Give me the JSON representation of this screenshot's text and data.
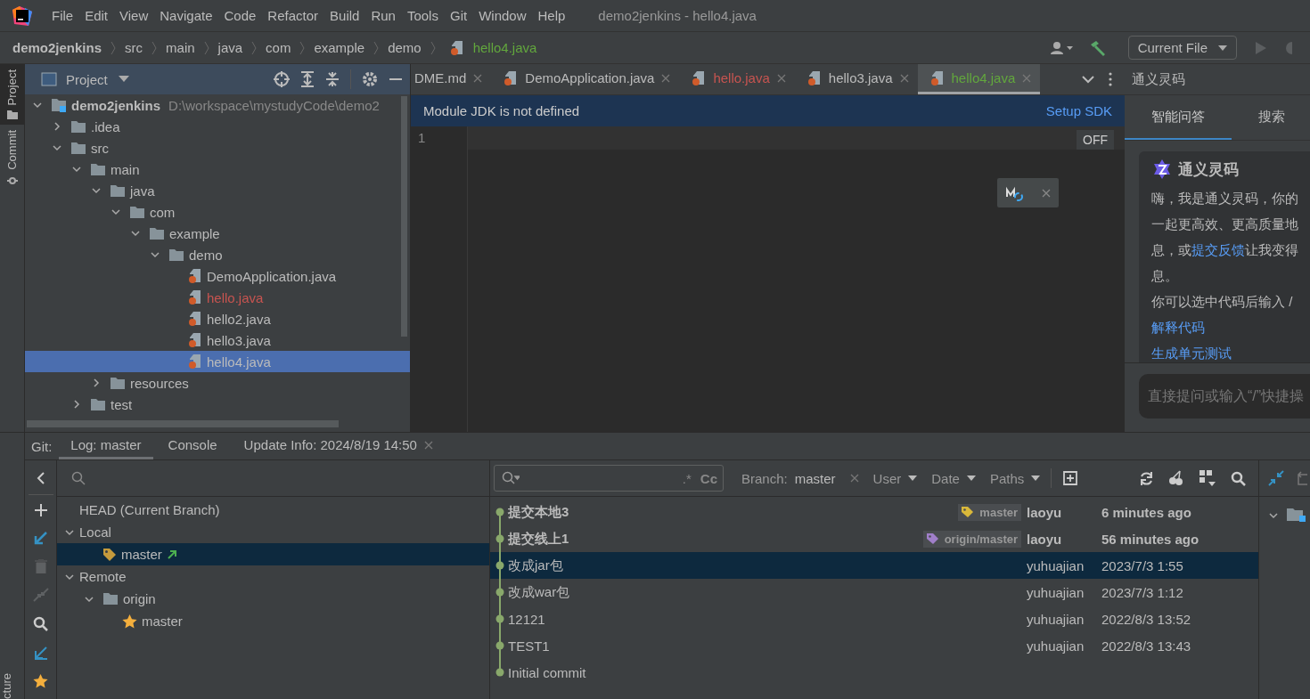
{
  "title": "demo2jenkins - hello4.java",
  "menu": [
    "File",
    "Edit",
    "View",
    "Navigate",
    "Code",
    "Refactor",
    "Build",
    "Run",
    "Tools",
    "Git",
    "Window",
    "Help"
  ],
  "breadcrumb": [
    {
      "label": "demo2jenkins",
      "kind": "project"
    },
    {
      "label": "src",
      "kind": "folder"
    },
    {
      "label": "main",
      "kind": "folder"
    },
    {
      "label": "java",
      "kind": "folder"
    },
    {
      "label": "com",
      "kind": "folder"
    },
    {
      "label": "example",
      "kind": "folder"
    },
    {
      "label": "demo",
      "kind": "folder"
    },
    {
      "label": "hello4.java",
      "kind": "file",
      "color": "#62a73d"
    }
  ],
  "run_config": "Current File",
  "side_tabs": [
    {
      "label": "Project",
      "kind": "project",
      "selected": true
    },
    {
      "label": "Commit",
      "kind": "commit",
      "selected": false
    }
  ],
  "side_tab_bottom": "cture",
  "project": {
    "title": "Project",
    "tree": [
      {
        "label": "demo2jenkins",
        "kind": "module",
        "path": "D:\\workspace\\mystudyCode\\demo2",
        "expanded": true,
        "selected": false,
        "children": [
          {
            "label": ".idea",
            "kind": "folder",
            "expanded": false,
            "selected": false
          },
          {
            "label": "src",
            "kind": "folder",
            "expanded": true,
            "selected": false,
            "children": [
              {
                "label": "main",
                "kind": "folder",
                "expanded": true,
                "selected": false,
                "children": [
                  {
                    "label": "java",
                    "kind": "folder",
                    "expanded": true,
                    "selected": false,
                    "children": [
                      {
                        "label": "com",
                        "kind": "folder",
                        "expanded": true,
                        "selected": false,
                        "children": [
                          {
                            "label": "example",
                            "kind": "folder",
                            "expanded": true,
                            "selected": false,
                            "children": [
                              {
                                "label": "demo",
                                "kind": "folder",
                                "expanded": true,
                                "selected": false,
                                "children": [
                                  {
                                    "label": "DemoApplication.java",
                                    "kind": "file",
                                    "color": "#bbbbbb",
                                    "selected": false
                                  },
                                  {
                                    "label": "hello.java",
                                    "kind": "file",
                                    "color": "#c75450",
                                    "selected": false
                                  },
                                  {
                                    "label": "hello2.java",
                                    "kind": "file",
                                    "color": "#bbbbbb",
                                    "selected": false
                                  },
                                  {
                                    "label": "hello3.java",
                                    "kind": "file",
                                    "color": "#bbbbbb",
                                    "selected": false
                                  },
                                  {
                                    "label": "hello4.java",
                                    "kind": "file",
                                    "color": "#bbbbbb",
                                    "selected": true
                                  }
                                ]
                              }
                            ]
                          }
                        ]
                      }
                    ]
                  },
                  {
                    "label": "resources",
                    "kind": "folder",
                    "expanded": false,
                    "selected": false
                  }
                ]
              },
              {
                "label": "test",
                "kind": "folder",
                "expanded": false,
                "selected": false
              }
            ]
          }
        ]
      }
    ]
  },
  "editor": {
    "tabs": [
      {
        "label": "DME.md",
        "kind": "text",
        "color": "#bbbbbb",
        "selected": false
      },
      {
        "label": "DemoApplication.java",
        "kind": "java",
        "color": "#bbbbbb",
        "selected": false
      },
      {
        "label": "hello.java",
        "kind": "java",
        "color": "#c75450",
        "selected": false
      },
      {
        "label": "hello3.java",
        "kind": "java",
        "color": "#bbbbbb",
        "selected": false
      },
      {
        "label": "hello4.java",
        "kind": "java",
        "color": "#62a73d",
        "selected": true
      }
    ],
    "banner": {
      "message": "Module JDK is not defined",
      "action": "Setup SDK"
    },
    "line_numbers": [
      "1"
    ],
    "badge": "OFF"
  },
  "assistant": {
    "title": "通义灵码",
    "tabs": [
      {
        "label": "智能问答",
        "selected": true
      },
      {
        "label": "搜索",
        "selected": false
      }
    ],
    "card_title": "通义灵码",
    "lines": [
      [
        {
          "text": "嗨，我是通义灵码，你的"
        }
      ],
      [
        {
          "text": "一起更高效、更高质量地"
        }
      ],
      [
        {
          "text": "息，或"
        },
        {
          "text": "提交反馈",
          "kind": "link"
        },
        {
          "text": "让我变得"
        }
      ],
      [
        {
          "text": "息。"
        }
      ],
      [
        {
          "text": "你可以选中代码后输入 /"
        }
      ]
    ],
    "links": [
      "解释代码",
      "生成单元测试"
    ],
    "placeholder": "直接提问或输入“/”快捷操"
  },
  "git": {
    "label": "Git:",
    "tabs": [
      {
        "label": "Log: master",
        "selected": true,
        "closable": false
      },
      {
        "label": "Console",
        "selected": false,
        "closable": false
      },
      {
        "label": "Update Info: 2024/8/19 14:50",
        "selected": false,
        "closable": true
      }
    ],
    "branches": [
      {
        "label": "HEAD (Current Branch)",
        "selected": false
      },
      {
        "label": "Local",
        "expanded": true,
        "selected": false,
        "children": [
          {
            "label": "master",
            "kind": "local",
            "selected": true
          }
        ]
      },
      {
        "label": "Remote",
        "expanded": true,
        "selected": false,
        "children": [
          {
            "label": "origin",
            "kind": "folder",
            "expanded": true,
            "selected": false,
            "children": [
              {
                "label": "master",
                "kind": "favorite",
                "selected": false
              }
            ]
          }
        ]
      }
    ],
    "search": {
      "regex": ".*",
      "case": "Cc"
    },
    "branch_filter": {
      "label": "Branch:",
      "value": "master"
    },
    "filters": [
      "User",
      "Date",
      "Paths"
    ],
    "commits": [
      {
        "subject": "提交本地3",
        "tag": {
          "label": "master",
          "color": "#d9b83a"
        },
        "author": "laoyu",
        "date": "6 minutes ago",
        "bold": true,
        "selected": false
      },
      {
        "subject": "提交线上1",
        "tag": {
          "label": "origin/master",
          "color": "#a07fc9"
        },
        "author": "laoyu",
        "date": "56 minutes ago",
        "bold": true,
        "selected": false
      },
      {
        "subject": "改成jar包",
        "author": "yuhuajian",
        "date": "2023/7/3 1:55",
        "bold": false,
        "selected": true
      },
      {
        "subject": "改成war包",
        "author": "yuhuajian",
        "date": "2023/7/3 1:12",
        "bold": false,
        "selected": false
      },
      {
        "subject": "12121",
        "author": "yuhuajian",
        "date": "2022/8/3 13:52",
        "bold": false,
        "selected": false
      },
      {
        "subject": "TEST1",
        "author": "yuhuajian",
        "date": "2022/8/3 13:43",
        "bold": false,
        "selected": false
      },
      {
        "subject": "Initial commit",
        "bold": false,
        "selected": false
      }
    ]
  }
}
